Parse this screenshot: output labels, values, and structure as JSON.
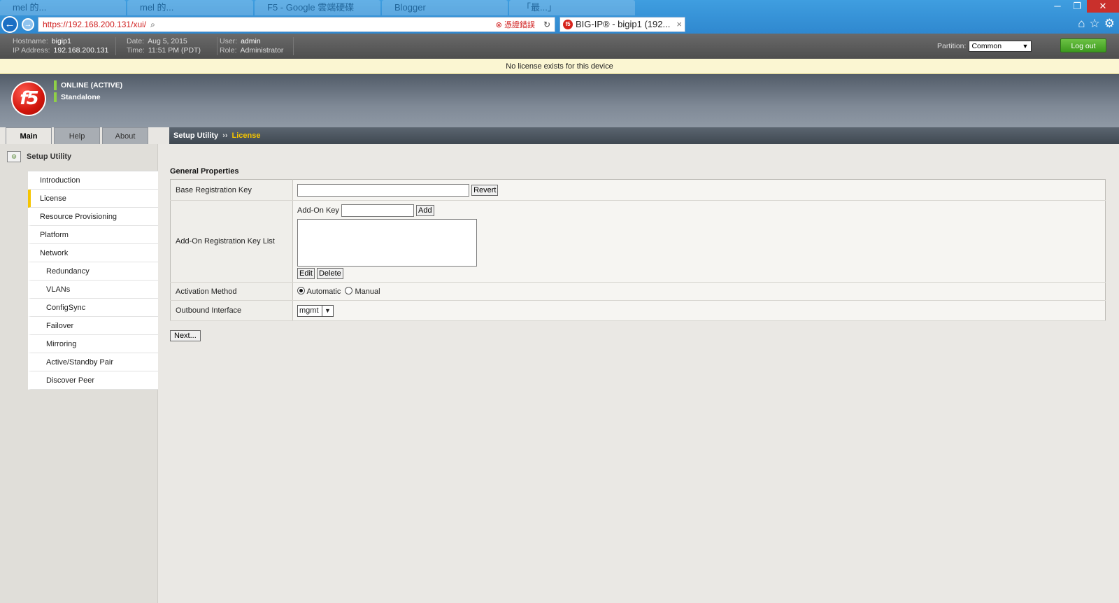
{
  "browser": {
    "url": "https://192.168.200.131/xui/",
    "cert_error": "憑證錯誤",
    "active_tab_title": "BIG-IP® - bigip1 (192...",
    "background_tabs": [
      "mel 的...",
      "mel 的...",
      "F5 - Google 雲端硬碟",
      "Blogger",
      "「最...」"
    ]
  },
  "header": {
    "hostname_label": "Hostname:",
    "hostname": "bigip1",
    "ip_label": "IP Address:",
    "ip": "192.168.200.131",
    "date_label": "Date:",
    "date": "Aug 5, 2015",
    "time_label": "Time:",
    "time": "11:51 PM (PDT)",
    "user_label": "User:",
    "user": "admin",
    "role_label": "Role:",
    "role": "Administrator",
    "partition_label": "Partition:",
    "partition_value": "Common",
    "logout_label": "Log out"
  },
  "notice": "No license exists for this device",
  "status": {
    "line1": "ONLINE (ACTIVE)",
    "line2": "Standalone",
    "logo_text": "f5"
  },
  "nav": {
    "tabs": [
      "Main",
      "Help",
      "About"
    ],
    "section": "Setup Utility",
    "items": [
      {
        "label": "Introduction"
      },
      {
        "label": "License"
      },
      {
        "label": "Resource Provisioning"
      },
      {
        "label": "Platform"
      },
      {
        "label": "Network"
      },
      {
        "label": "Redundancy"
      },
      {
        "label": "VLANs"
      },
      {
        "label": "ConfigSync"
      },
      {
        "label": "Failover"
      },
      {
        "label": "Mirroring"
      },
      {
        "label": "Active/Standby Pair"
      },
      {
        "label": "Discover Peer"
      }
    ]
  },
  "breadcrumb": {
    "parent": "Setup Utility",
    "separator": "››",
    "current": "License"
  },
  "form": {
    "section_title": "General Properties",
    "base_key_label": "Base Registration Key",
    "base_key_value": "",
    "revert_label": "Revert",
    "addon_list_label": "Add-On Registration Key List",
    "addon_key_label": "Add-On Key",
    "addon_key_value": "",
    "add_label": "Add",
    "edit_label": "Edit",
    "delete_label": "Delete",
    "activation_label": "Activation Method",
    "activation_automatic": "Automatic",
    "activation_manual": "Manual",
    "outbound_label": "Outbound Interface",
    "outbound_value": "mgmt",
    "next_label": "Next..."
  },
  "colors": {
    "accent_yellow": "#f5c400",
    "logout_green": "#4fae2c",
    "f5_red": "#d6231b",
    "status_green": "#8fd047"
  }
}
